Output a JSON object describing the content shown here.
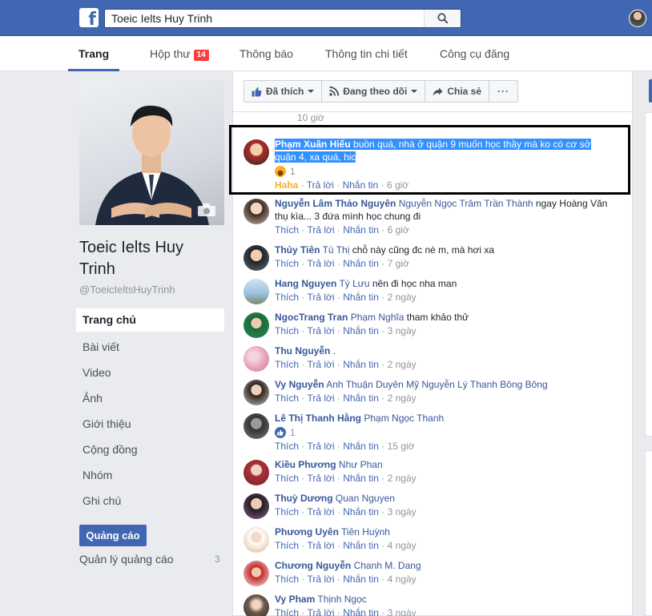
{
  "topbar": {
    "search_value": "Toeic Ielts Huy Trinh"
  },
  "tabs": [
    {
      "label": "Trang"
    },
    {
      "label": "Hộp thư",
      "badge": "14"
    },
    {
      "label": "Thông báo"
    },
    {
      "label": "Thông tin chi tiết"
    },
    {
      "label": "Công cụ đăng"
    }
  ],
  "page": {
    "name": "Toeic Ielts Huy Trinh",
    "handle": "@ToeicIeltsHuyTrinh"
  },
  "nav": [
    {
      "label": "Trang chủ"
    },
    {
      "label": "Bài viết"
    },
    {
      "label": "Video"
    },
    {
      "label": "Ảnh"
    },
    {
      "label": "Giới thiệu"
    },
    {
      "label": "Cộng đồng"
    },
    {
      "label": "Nhóm"
    },
    {
      "label": "Ghi chú"
    }
  ],
  "ads": {
    "button_label": "Quảng cáo",
    "manage_label": "Quản lý quảng cáo",
    "manage_count": "3"
  },
  "actions": {
    "liked": "Đã thích",
    "following": "Đang theo dõi",
    "share": "Chia sẻ",
    "more": "···"
  },
  "feed": {
    "previous_time": "10 giờ"
  },
  "labels": {
    "like": "Thích",
    "reply": "Trả lời",
    "message": "Nhắn tin",
    "haha": "Haha",
    "sep": " · "
  },
  "comments": [
    {
      "name": "Phạm Xuân Hiếu",
      "text": "buồn quá, nhà ở quận 9 muốn học thầy mà ko có cơ sở quận 4, xa quá, hic",
      "reaction_count": "1",
      "reaction": "haha",
      "time": "6 giờ"
    },
    {
      "name": "Nguyễn Lâm Thảo Nguyên",
      "tags": "Nguyễn Ngọc Trâm Trần Thành",
      "text": "ngay Hoàng Văn thụ kìa... 3 đứa mình học chung đi",
      "time": "6 giờ"
    },
    {
      "name": "Thủy Tiên",
      "tags": "Tú Thị",
      "text": "chỗ này cũng đc nè m, mà hơi xa",
      "time": "7 giờ"
    },
    {
      "name": "Hang Nguyen",
      "tags": "Tý Lưu",
      "text": "nên đi học nha man",
      "time": "2 ngày"
    },
    {
      "name": "NgocTrang Tran",
      "tags": "Phạm Nghĩa",
      "text": "tham khảo thử",
      "time": "3 ngày"
    },
    {
      "name": "Thu Nguyễn",
      "tags": "",
      "text": ".",
      "time": "2 ngày"
    },
    {
      "name": "Vy Nguyễn",
      "tags": "Anh Thuận Duyên Mỹ Nguyễn Lý Thanh Bông Bông",
      "text": "",
      "time": "2 ngày"
    },
    {
      "name": "Lê Thị Thanh Hằng",
      "tags": "Phạm Ngọc Thanh",
      "text": "",
      "reaction_count": "1",
      "reaction": "like",
      "time": "15 giờ"
    },
    {
      "name": "Kiều Phương",
      "tags": "Như Phan",
      "text": "",
      "time": "2 ngày"
    },
    {
      "name": "Thuỳ Dương",
      "tags": "Quan Nguyen",
      "text": "",
      "time": "3 ngày"
    },
    {
      "name": "Phương Uyên",
      "tags": "Tiên Huỳnh",
      "text": "",
      "time": "4 ngày"
    },
    {
      "name": "Chương Nguyễn",
      "tags": "Chanh M. Dang",
      "text": "",
      "time": "4 ngày"
    },
    {
      "name": "Vy Pham",
      "tags": "Thịnh Ngọc",
      "text": "",
      "time": "3 ngày"
    }
  ]
}
